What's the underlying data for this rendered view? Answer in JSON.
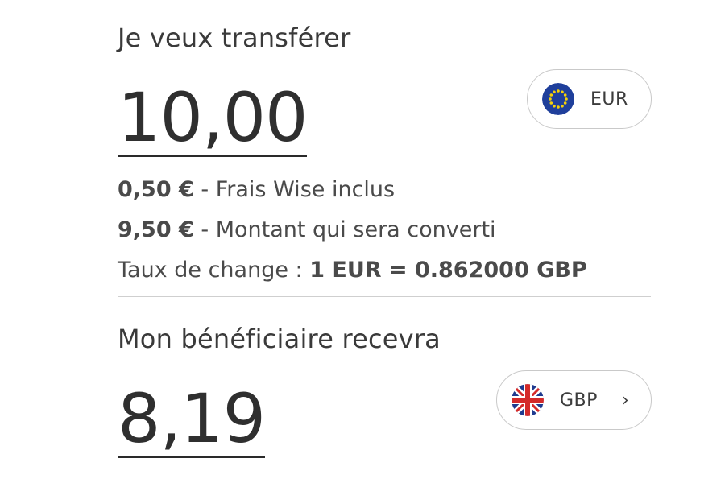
{
  "send": {
    "label": "Je veux transférer",
    "amount": "10,00",
    "currency": {
      "code": "EUR",
      "icon": "eu-flag-icon"
    }
  },
  "details": {
    "fee_value": "0,50 €",
    "fee_text": " - Frais Wise inclus",
    "converted_value": "9,50 €",
    "converted_text": " - Montant qui sera converti",
    "rate_prefix": "Taux de change : ",
    "rate_value": "1 EUR = 0.862000 GBP"
  },
  "receive": {
    "label": "Mon bénéficiaire recevra",
    "amount": "8,19",
    "currency": {
      "code": "GBP",
      "icon": "uk-flag-icon",
      "chevron": "›"
    }
  },
  "colors": {
    "text": "#3c3c3c",
    "eu_blue": "#1f3f9b",
    "eu_star": "#f5d10a",
    "uk_blue": "#1f3a8f",
    "uk_red": "#d42a2a"
  }
}
